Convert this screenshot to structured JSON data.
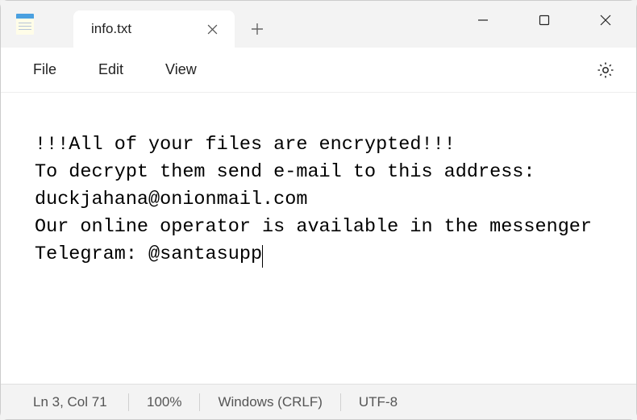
{
  "tab": {
    "title": "info.txt"
  },
  "menu": {
    "file": "File",
    "edit": "Edit",
    "view": "View"
  },
  "content": {
    "text": "!!!All of your files are encrypted!!!\nTo decrypt them send e-mail to this address: duckjahana@onionmail.com\nOur online operator is available in the messenger Telegram: @santasupp"
  },
  "status": {
    "position": "Ln 3, Col 71",
    "zoom": "100%",
    "lineending": "Windows (CRLF)",
    "encoding": "UTF-8"
  }
}
